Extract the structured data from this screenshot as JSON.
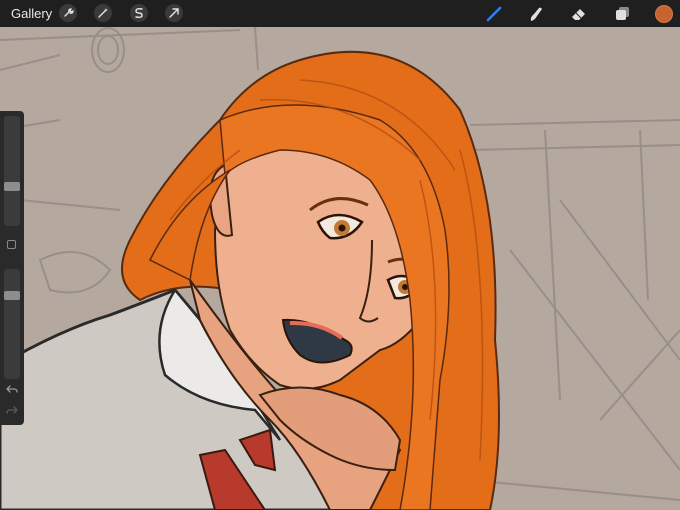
{
  "app": {
    "gallery_label": "Gallery"
  },
  "toolbar_left": [
    {
      "name": "actions-wrench-icon"
    },
    {
      "name": "adjustments-magic-wand-icon"
    },
    {
      "name": "selection-icon"
    },
    {
      "name": "transform-arrow-icon"
    }
  ],
  "toolbar_right": [
    {
      "name": "brush-icon",
      "active": true
    },
    {
      "name": "smudge-icon",
      "active": false
    },
    {
      "name": "eraser-icon",
      "active": false
    },
    {
      "name": "layers-icon",
      "active": false
    }
  ],
  "colors": {
    "current_color": "#c8622e",
    "accent_active": "#2f7ff2",
    "toolbar_bg": "#1f1f1f",
    "canvas_bg": "#b4a89f",
    "hair": "#e8741f",
    "skin": "#eeb08e",
    "shirt": "#e6e2df",
    "tie": "#b73a2d"
  },
  "sidebar": {
    "brush_size_level": 0.35,
    "opacity_level": 0.22,
    "undo_icon": "undo-arrow-icon",
    "redo_icon": "redo-arrow-icon"
  }
}
